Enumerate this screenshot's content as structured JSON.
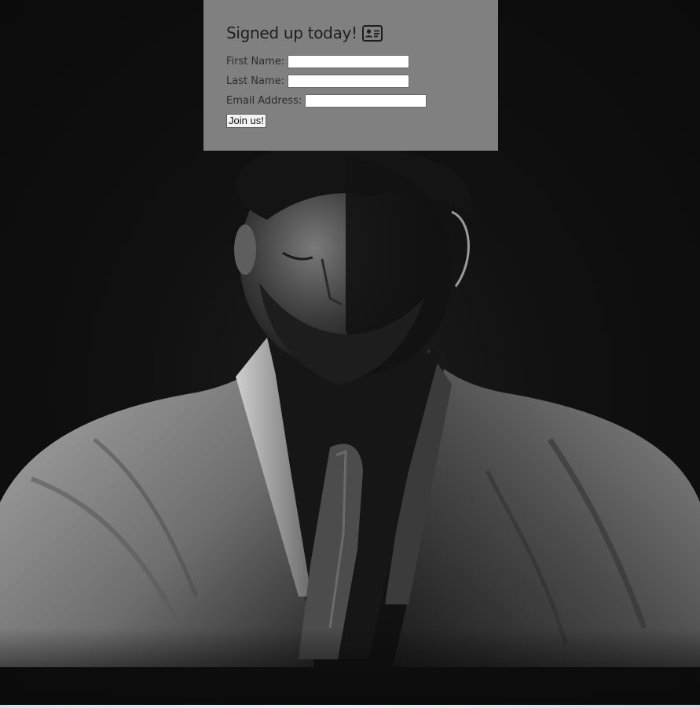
{
  "signup": {
    "title": "Signed up today!",
    "icon": "id-card-icon",
    "fields": [
      {
        "label": "First Name:",
        "value": "",
        "placeholder": ""
      },
      {
        "label": "Last Name:",
        "value": "",
        "placeholder": ""
      },
      {
        "label": "Email Address:",
        "value": "",
        "placeholder": ""
      }
    ],
    "submit_label": "Join us!"
  },
  "colors": {
    "card_background": "#808080",
    "page_background": "#0d0d0d"
  },
  "hero": {
    "image": "grayscale-portrait-photo"
  }
}
